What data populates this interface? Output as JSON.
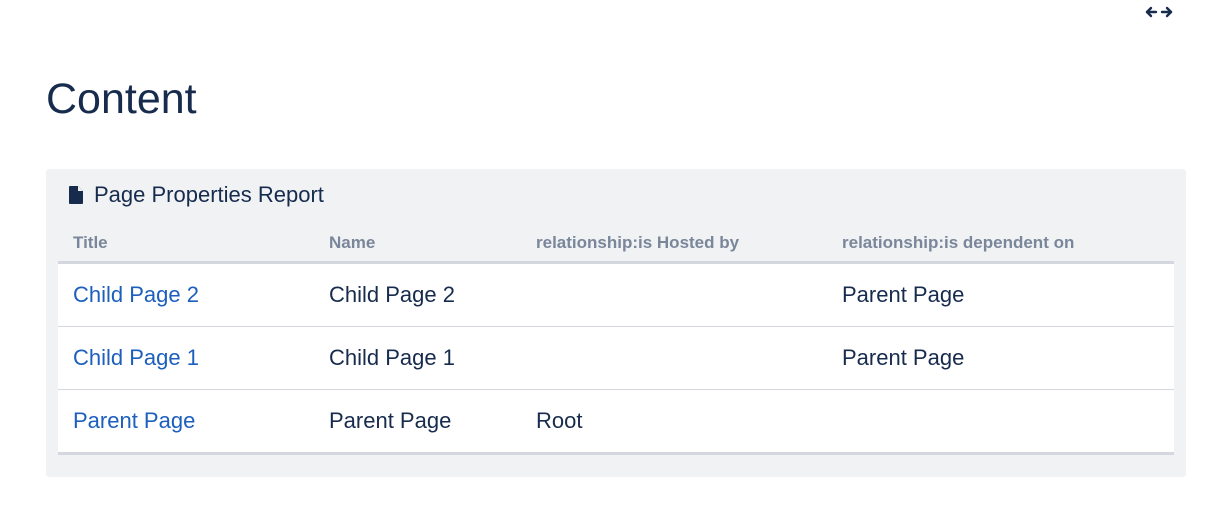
{
  "toolbar": {
    "width_toggle_icon": "expand-width-icon"
  },
  "page": {
    "title": "Content"
  },
  "report": {
    "icon": "document-icon",
    "title": "Page Properties Report",
    "columns": [
      "Title",
      "Name",
      "relationship:is Hosted by",
      "relationship:is dependent on"
    ],
    "rows": [
      {
        "title": "Child Page 2",
        "name": "Child Page 2",
        "hosted_by": "",
        "dependent_on": "Parent Page"
      },
      {
        "title": "Child Page 1",
        "name": "Child Page 1",
        "hosted_by": "",
        "dependent_on": "Parent Page"
      },
      {
        "title": "Parent Page",
        "name": "Parent Page",
        "hosted_by": "Root",
        "dependent_on": ""
      }
    ]
  },
  "colors": {
    "link": "#1c5fbd",
    "text": "#172b4d",
    "header_text": "#7a869a",
    "panel_bg": "#f0f2f4"
  }
}
